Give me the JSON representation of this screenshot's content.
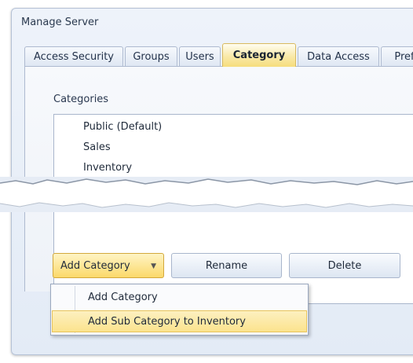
{
  "window": {
    "title": "Manage Server"
  },
  "tabs": [
    {
      "label": "Access Security"
    },
    {
      "label": "Groups"
    },
    {
      "label": "Users"
    },
    {
      "label": "Category",
      "active": true
    },
    {
      "label": "Data Access"
    },
    {
      "label": "Pref"
    }
  ],
  "categories": {
    "label": "Categories",
    "items": [
      "Public (Default)",
      "Sales",
      "Inventory"
    ]
  },
  "buttons": {
    "add_category": "Add Category",
    "rename": "Rename",
    "delete": "Delete",
    "caret_icon": "chevron-down-icon"
  },
  "dropdown": {
    "items": [
      "Add Category",
      "Add Sub Category to Inventory"
    ],
    "highlighted_index": 1
  },
  "colors": {
    "accent": "#f9e08a",
    "accent_border": "#d9ba5e",
    "panel_bg": "#eef3fa",
    "border": "#aebad0"
  }
}
